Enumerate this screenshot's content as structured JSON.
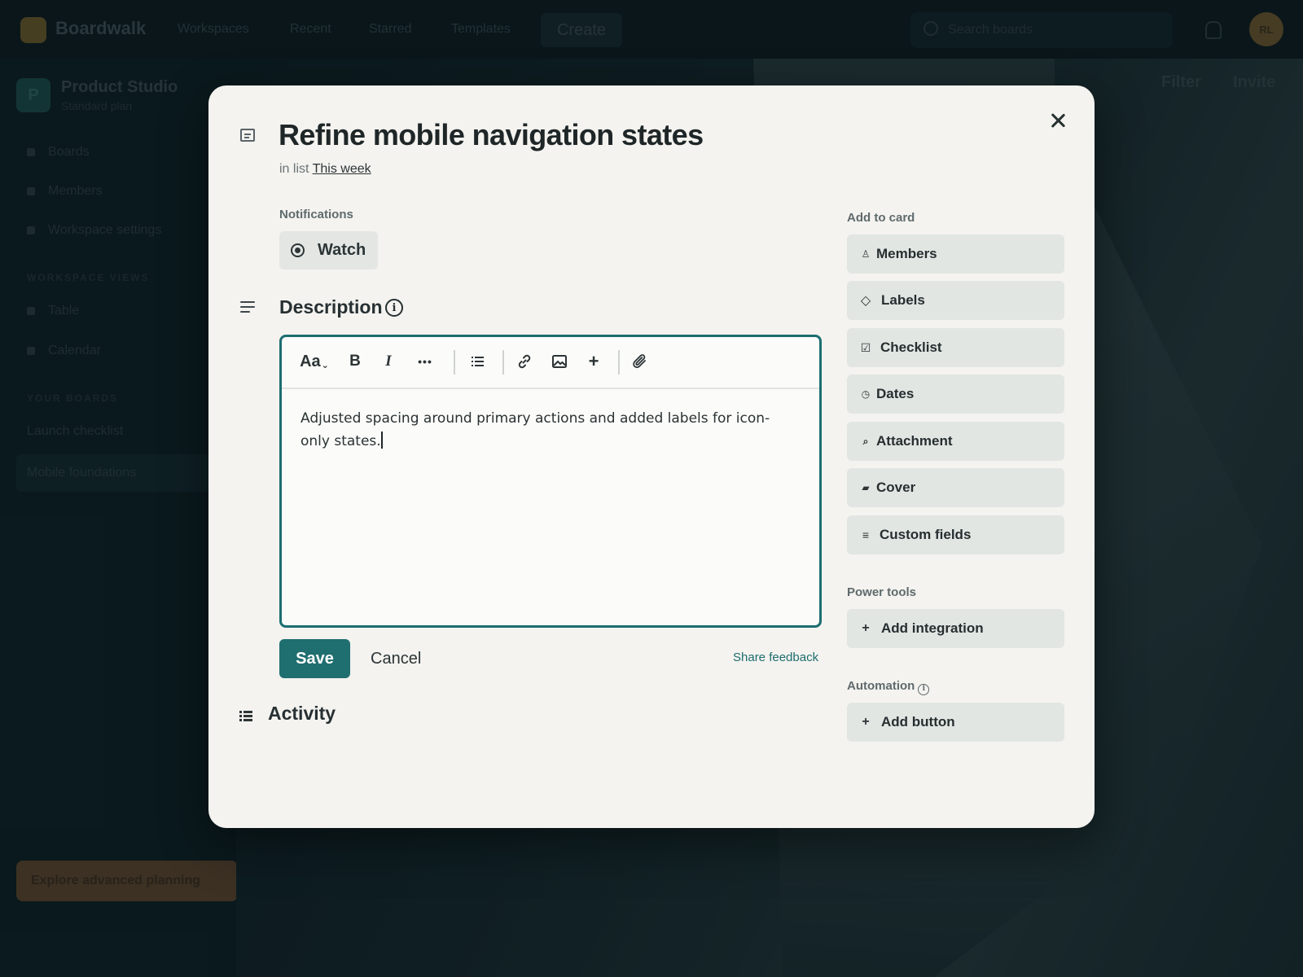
{
  "app": {
    "logo_text": "Boardwalk",
    "nav": [
      "Workspaces",
      "Recent",
      "Starred",
      "Templates"
    ],
    "create_label": "Create",
    "search_placeholder": "Search boards",
    "avatar_initials": "RL"
  },
  "sidebar": {
    "workspace_initial": "P",
    "workspace_name": "Product Studio",
    "workspace_plan": "Standard plan",
    "items": [
      "Boards",
      "Members",
      "Workspace settings"
    ],
    "views_heading": "WORKSPACE VIEWS",
    "views": [
      "Table",
      "Calendar"
    ],
    "boards_heading": "YOUR BOARDS",
    "boards": [
      "Launch checklist",
      "Mobile foundations"
    ],
    "promo_label": "Explore advanced planning"
  },
  "board": {
    "filter_label": "Filter",
    "invite_label": "Invite"
  },
  "card": {
    "title": "Refine mobile navigation states",
    "in_list_prefix": "in list",
    "list_name": "This week",
    "notifications_label": "Notifications",
    "watch_label": "Watch",
    "description_title": "Description",
    "description_text": "Adjusted spacing around primary actions and added labels for icon-only states.",
    "toolbar": {
      "text_style": "Aa",
      "bold": "B",
      "italic": "I",
      "more": "•••"
    },
    "save_label": "Save",
    "cancel_label": "Cancel",
    "feedback_label": "Share feedback",
    "activity_title": "Activity"
  },
  "add_to_card": {
    "label": "Add to card",
    "items": [
      "Members",
      "Labels",
      "Checklist",
      "Dates",
      "Attachment",
      "Cover",
      "Custom fields"
    ]
  },
  "power_tools": {
    "label": "Power tools",
    "add_integration": "Add integration"
  },
  "automation": {
    "label": "Automation",
    "add_button": "Add button"
  },
  "colors": {
    "accent": "#1f6e70",
    "modal_bg": "#f4f3ef",
    "button_bg": "#e2e6e3"
  }
}
